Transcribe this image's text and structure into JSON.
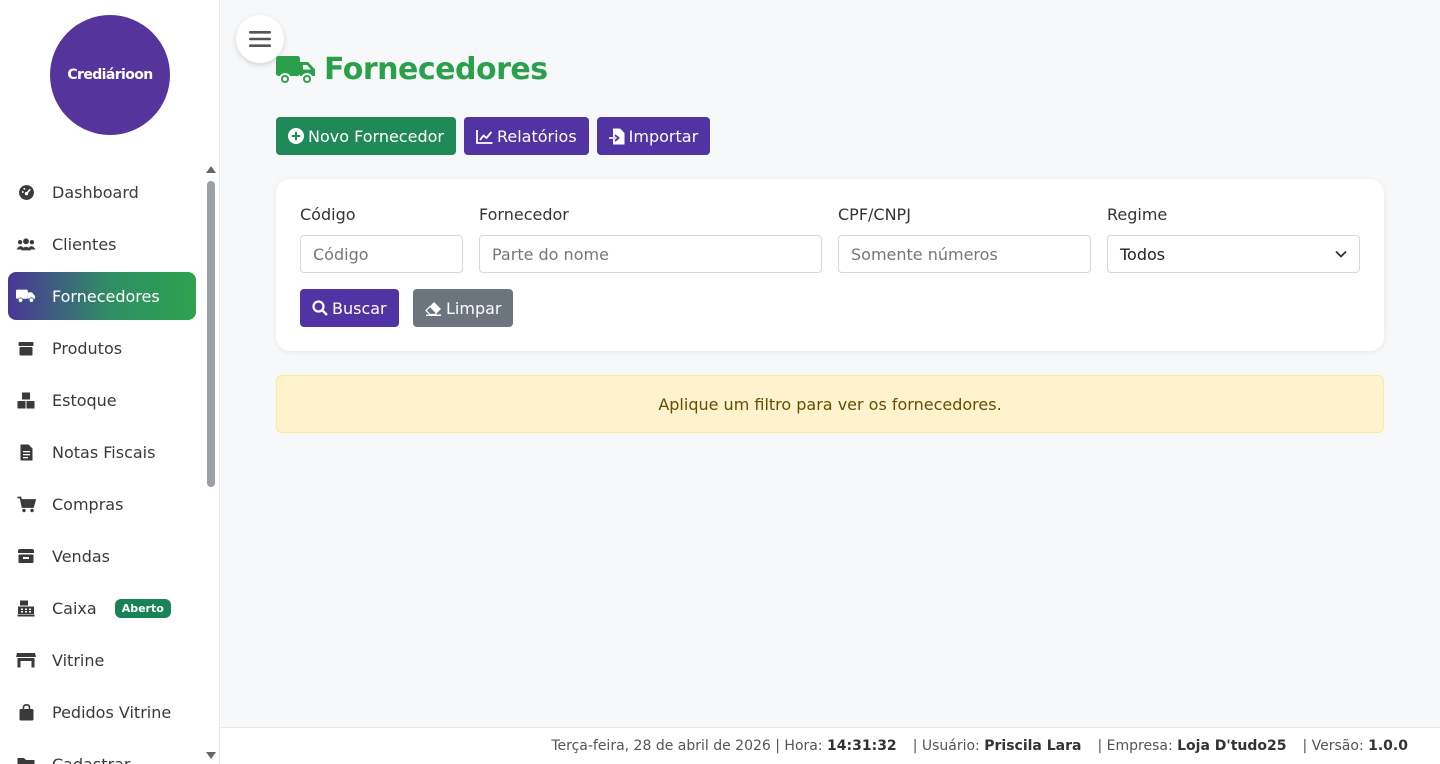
{
  "app": {
    "logo_text": "Crediárioon"
  },
  "sidebar": {
    "items": [
      {
        "label": "Dashboard",
        "icon": "gauge-icon"
      },
      {
        "label": "Clientes",
        "icon": "users-icon"
      },
      {
        "label": "Fornecedores",
        "icon": "truck-icon",
        "active": true
      },
      {
        "label": "Produtos",
        "icon": "box-icon"
      },
      {
        "label": "Estoque",
        "icon": "boxes-icon"
      },
      {
        "label": "Notas Fiscais",
        "icon": "file-invoice-icon"
      },
      {
        "label": "Compras",
        "icon": "cart-icon"
      },
      {
        "label": "Vendas",
        "icon": "cash-register-icon"
      },
      {
        "label": "Caixa",
        "icon": "calculator-icon",
        "badge": "Aberto"
      },
      {
        "label": "Vitrine",
        "icon": "store-icon"
      },
      {
        "label": "Pedidos Vitrine",
        "icon": "bag-icon"
      },
      {
        "label": "Cadastrar",
        "icon": "folder-icon"
      }
    ]
  },
  "header": {
    "title": "Fornecedores",
    "title_icon": "truck-icon"
  },
  "actions": {
    "new_label": "Novo Fornecedor",
    "reports_label": "Relatórios",
    "import_label": "Importar"
  },
  "filters": {
    "codigo": {
      "label": "Código",
      "placeholder": "Código",
      "value": ""
    },
    "fornecedor": {
      "label": "Fornecedor",
      "placeholder": "Parte do nome",
      "value": ""
    },
    "cpf": {
      "label": "CPF/CNPJ",
      "placeholder": "Somente números",
      "value": ""
    },
    "regime": {
      "label": "Regime",
      "value": "Todos"
    },
    "search_label": "Buscar",
    "clear_label": "Limpar"
  },
  "alert": {
    "text": "Aplique um filtro para ver os fornecedores."
  },
  "footer": {
    "date": "Terça-feira, 28 de abril de 2026",
    "hora_label": "| Hora:",
    "hora": "14:31:32",
    "usuario_label": "| Usuário:",
    "usuario": "Priscila Lara",
    "empresa_label": "| Empresa:",
    "empresa": "Loja D'tudo25",
    "versao_label": "| Versão:",
    "versao": "1.0.0"
  },
  "colors": {
    "brand_purple": "#55359c",
    "brand_green": "#2aa04a",
    "button_green": "#1f8a57",
    "alert_bg": "#fff3cd"
  }
}
